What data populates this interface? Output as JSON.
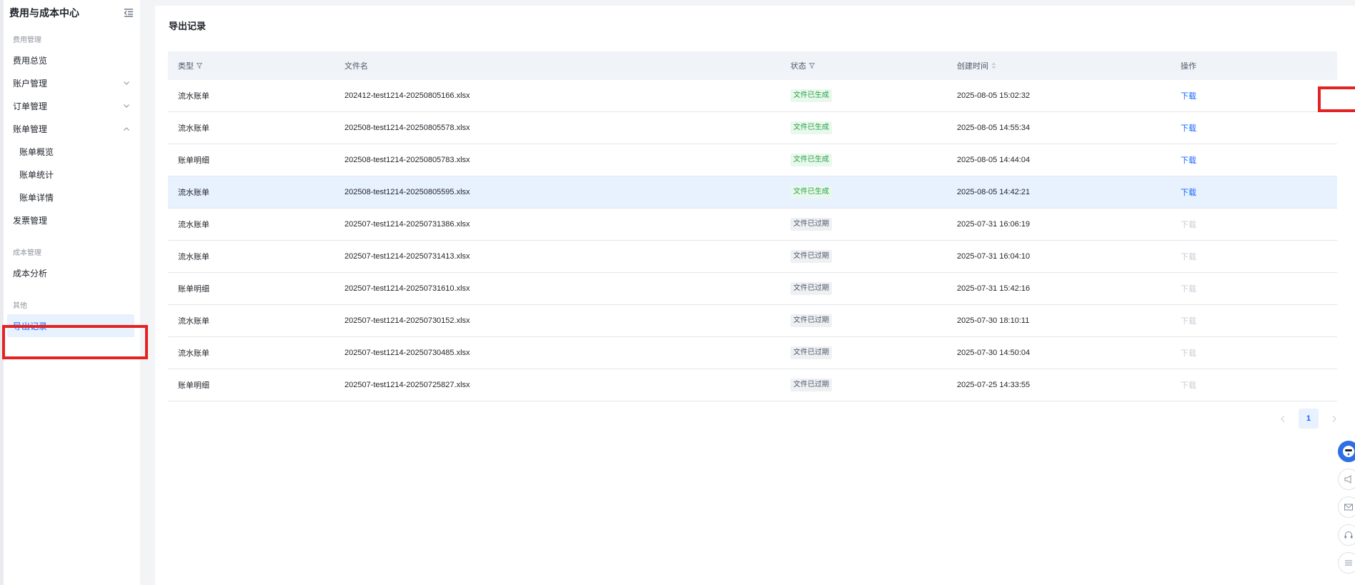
{
  "sidebar": {
    "title": "费用与成本中心",
    "collapse_icon": "menu-fold-icon",
    "groups": [
      {
        "label": "费用管理"
      },
      {
        "label": "成本管理"
      },
      {
        "label": "其他"
      }
    ],
    "items": {
      "overview": "费用总览",
      "account": "账户管理",
      "order": "订单管理",
      "bill": "账单管理",
      "bill_overview": "账单概览",
      "bill_stats": "账单统计",
      "bill_detail": "账单详情",
      "invoice": "发票管理",
      "cost_analysis": "成本分析",
      "export": "导出记录"
    }
  },
  "main": {
    "title": "导出记录",
    "columns": [
      "类型",
      "文件名",
      "状态",
      "创建时间",
      "操作"
    ],
    "rows": [
      {
        "type": "流水账单",
        "file": "202412-test1214-20250805166.xlsx",
        "status": "文件已生成",
        "state": "ok",
        "time": "2025-08-05 15:02:32",
        "action": "下载"
      },
      {
        "type": "流水账单",
        "file": "202508-test1214-20250805578.xlsx",
        "status": "文件已生成",
        "state": "ok",
        "time": "2025-08-05 14:55:34",
        "action": "下载"
      },
      {
        "type": "账单明细",
        "file": "202508-test1214-20250805783.xlsx",
        "status": "文件已生成",
        "state": "ok",
        "time": "2025-08-05 14:44:04",
        "action": "下载"
      },
      {
        "type": "流水账单",
        "file": "202508-test1214-20250805595.xlsx",
        "status": "文件已生成",
        "state": "ok",
        "time": "2025-08-05 14:42:21",
        "action": "下载"
      },
      {
        "type": "流水账单",
        "file": "202507-test1214-20250731386.xlsx",
        "status": "文件已过期",
        "state": "expired",
        "time": "2025-07-31 16:06:19",
        "action": "下载"
      },
      {
        "type": "流水账单",
        "file": "202507-test1214-20250731413.xlsx",
        "status": "文件已过期",
        "state": "expired",
        "time": "2025-07-31 16:04:10",
        "action": "下载"
      },
      {
        "type": "账单明细",
        "file": "202507-test1214-20250731610.xlsx",
        "status": "文件已过期",
        "state": "expired",
        "time": "2025-07-31 15:42:16",
        "action": "下载"
      },
      {
        "type": "流水账单",
        "file": "202507-test1214-20250730152.xlsx",
        "status": "文件已过期",
        "state": "expired",
        "time": "2025-07-30 18:10:11",
        "action": "下载"
      },
      {
        "type": "流水账单",
        "file": "202507-test1214-20250730485.xlsx",
        "status": "文件已过期",
        "state": "expired",
        "time": "2025-07-30 14:50:04",
        "action": "下载"
      },
      {
        "type": "账单明细",
        "file": "202507-test1214-20250725827.xlsx",
        "status": "文件已过期",
        "state": "expired",
        "time": "2025-07-25 14:33:55",
        "action": "下载"
      }
    ],
    "pagination": {
      "current": "1"
    }
  },
  "colors": {
    "accent": "#1664ff",
    "success": "#2ba048",
    "highlight": "#e52222"
  }
}
